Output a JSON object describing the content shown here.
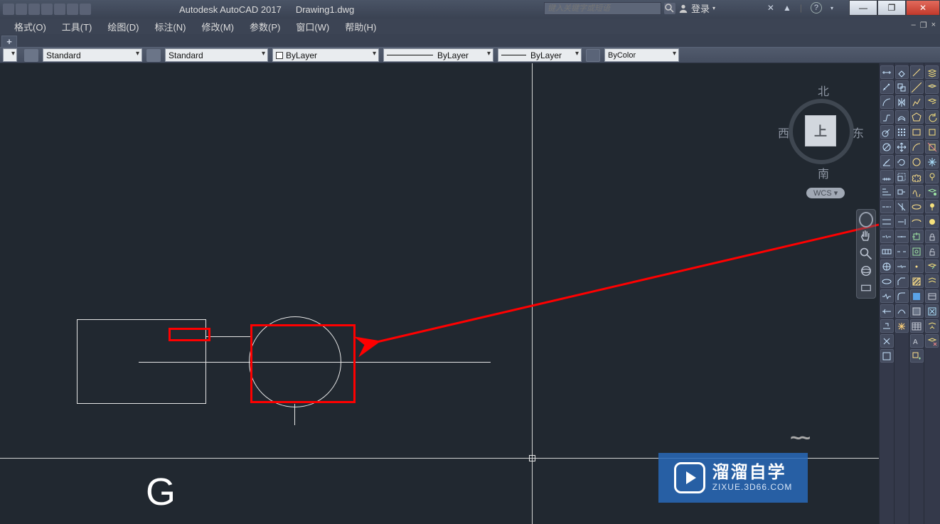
{
  "title": {
    "app": "Autodesk AutoCAD 2017",
    "doc": "Drawing1.dwg"
  },
  "search": {
    "placeholder": "键入关键字或短语"
  },
  "signin": {
    "label": "登录"
  },
  "menu": {
    "format": "格式(O)",
    "tools": "工具(T)",
    "draw": "绘图(D)",
    "dimension": "标注(N)",
    "modify": "修改(M)",
    "parametric": "参数(P)",
    "window": "窗口(W)",
    "help": "帮助(H)"
  },
  "plus_tab": "+",
  "props": {
    "textstyle": "Standard",
    "dimstyle": "Standard",
    "color": "ByLayer",
    "linetype": "ByLayer",
    "lineweight": "ByLayer",
    "plotstyle": "ByColor"
  },
  "viewcube": {
    "top": "上",
    "n": "北",
    "s": "南",
    "e": "东",
    "w": "西",
    "wcs": "WCS"
  },
  "canvas_text": {
    "g": "G"
  },
  "watermark": {
    "cn": "溜溜自学",
    "en": "ZIXUE.3D66.COM"
  },
  "win_controls": {
    "min": "—",
    "max": "❐",
    "close": "✕"
  },
  "doc_controls": {
    "min": "–",
    "max": "❐",
    "close": "×"
  }
}
